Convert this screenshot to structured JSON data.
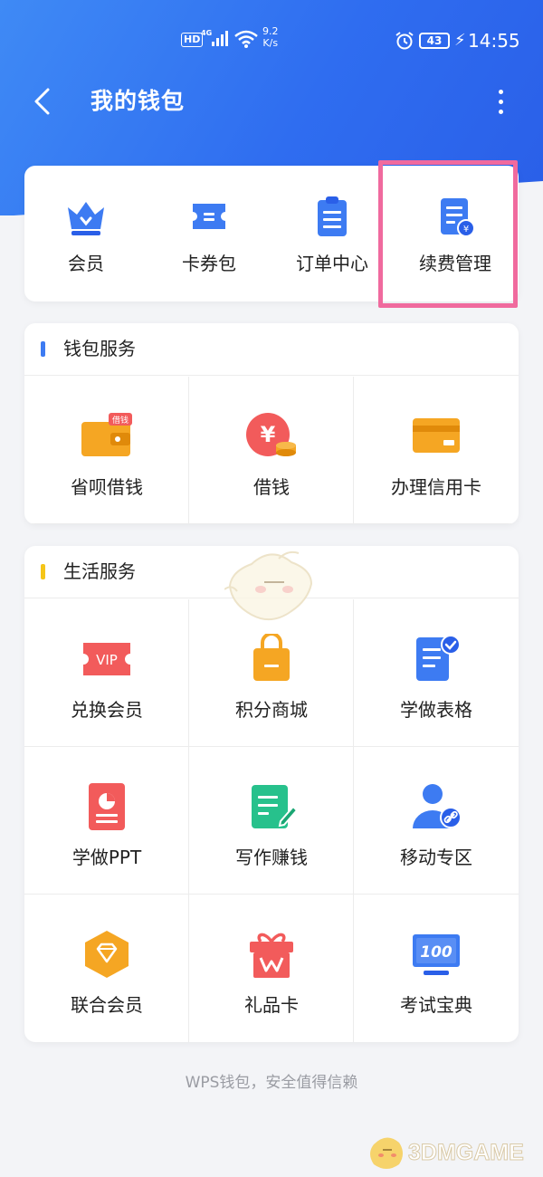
{
  "status_bar": {
    "hd": "HD",
    "network": "4G",
    "speed_value": "9.2",
    "speed_unit": "K/s",
    "battery": "43",
    "time": "14:55"
  },
  "header": {
    "title": "我的钱包",
    "back_icon": "chevron-left-icon",
    "more_icon": "more-vertical-icon"
  },
  "quick_actions": [
    {
      "label": "会员",
      "icon": "crown-icon"
    },
    {
      "label": "卡券包",
      "icon": "ticket-icon"
    },
    {
      "label": "订单中心",
      "icon": "clipboard-icon"
    },
    {
      "label": "续费管理",
      "icon": "renewal-document-icon"
    }
  ],
  "wallet_services": {
    "title": "钱包服务",
    "accent": "#3d7bf2",
    "items": [
      {
        "label": "省呗借钱",
        "icon": "wallet-icon",
        "badge": "借钱"
      },
      {
        "label": "借钱",
        "icon": "yuan-coins-icon"
      },
      {
        "label": "办理信用卡",
        "icon": "credit-card-icon"
      }
    ]
  },
  "life_services": {
    "title": "生活服务",
    "accent": "#f5c518",
    "items": [
      {
        "label": "兑换会员",
        "icon": "vip-ticket-icon",
        "tag": "VIP"
      },
      {
        "label": "积分商城",
        "icon": "shopping-bag-icon"
      },
      {
        "label": "学做表格",
        "icon": "checked-document-icon"
      },
      {
        "label": "学做PPT",
        "icon": "ppt-document-icon"
      },
      {
        "label": "写作赚钱",
        "icon": "edit-document-icon"
      },
      {
        "label": "移动专区",
        "icon": "user-link-icon"
      },
      {
        "label": "联合会员",
        "icon": "diamond-hexagon-icon"
      },
      {
        "label": "礼品卡",
        "icon": "gift-box-icon"
      },
      {
        "label": "考试宝典",
        "icon": "score-monitor-icon",
        "tag": "100"
      }
    ]
  },
  "footer": "WPS钱包，安全值得信赖",
  "watermark": "3DMGAME",
  "colors": {
    "header_blue": "#2f6df0",
    "highlight_pink": "#f06a9e",
    "icon_blue": "#3d7bf2",
    "icon_orange": "#f5a623",
    "icon_red": "#f25b5b",
    "icon_green": "#27c18c"
  }
}
